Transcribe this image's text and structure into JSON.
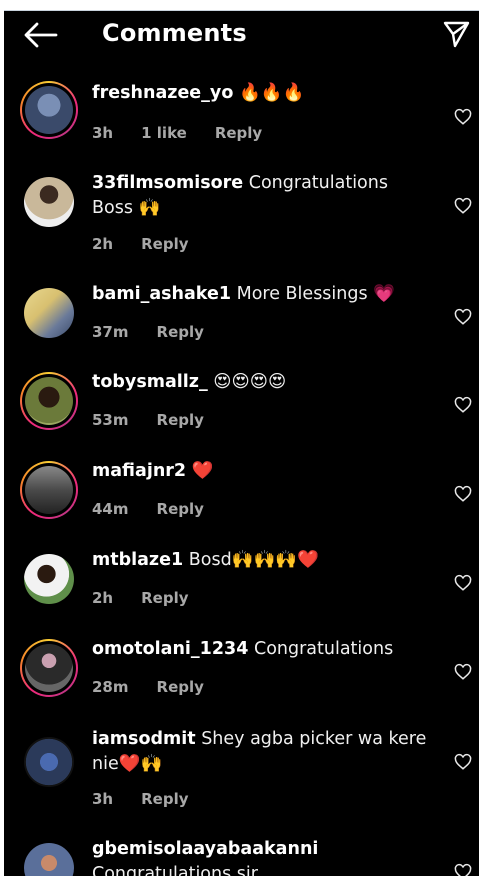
{
  "header": {
    "title": "Comments"
  },
  "comments": [
    {
      "user": "freshnazee_yo",
      "text": "🔥🔥🔥",
      "time": "3h",
      "likes": "1 like",
      "reply": "Reply",
      "avatar_bg": "#3a4a6a"
    },
    {
      "user": "33filmsomisore",
      "text": "Congratulations Boss 🙌",
      "time": "2h",
      "likes": "",
      "reply": "Reply",
      "avatar_bg": "#c9b89a"
    },
    {
      "user": "bami_ashake1",
      "text": "More Blessings 💗",
      "time": "37m",
      "likes": "",
      "reply": "Reply",
      "avatar_bg": "#d8c070"
    },
    {
      "user": "tobysmallz_",
      "text": "😍😍😍😍",
      "time": "53m",
      "likes": "",
      "reply": "Reply",
      "avatar_bg": "#6b7a3a"
    },
    {
      "user": "mafiajnr2",
      "text": "❤️",
      "time": "44m",
      "likes": "",
      "reply": "Reply",
      "avatar_bg": "#4a4a4a"
    },
    {
      "user": "mtblaze1",
      "text": "Bosd🙌🙌🙌❤️",
      "time": "2h",
      "likes": "",
      "reply": "Reply",
      "avatar_bg": "#5f8f4a"
    },
    {
      "user": "omotolani_1234",
      "text": "Congratulations",
      "time": "28m",
      "likes": "",
      "reply": "Reply",
      "avatar_bg": "#2a2a2a"
    },
    {
      "user": "iamsodmit",
      "text": "Shey agba picker wa kere nie❤️🙌",
      "time": "3h",
      "likes": "",
      "reply": "Reply",
      "avatar_bg": "#2b3a5a"
    },
    {
      "user": "gbemisolaayabaakanni",
      "text": "Congratulations sir",
      "time": "",
      "likes": "",
      "reply": "",
      "avatar_bg": "#5a6f9a"
    }
  ],
  "colors": {
    "background": "#000000",
    "text": "#f5f5f5",
    "muted": "#a8a8a8",
    "ring_start": "#f9ce34",
    "ring_end": "#ee2a7b"
  },
  "icons": {
    "back": "arrow-left-icon",
    "share": "paper-plane-icon",
    "like": "heart-icon"
  }
}
